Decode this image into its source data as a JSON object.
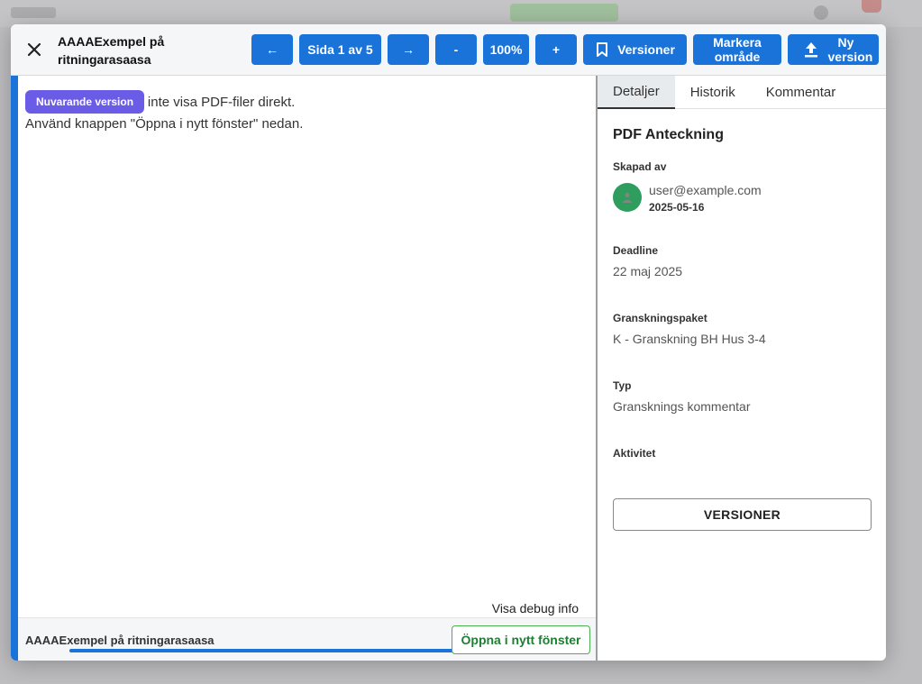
{
  "header": {
    "title": "AAAAExempel på ritningarasaasa",
    "prev_label": "←",
    "page_label": "Sida 1 av 5",
    "next_label": "→",
    "zoom_out_label": "-",
    "zoom_label": "100%",
    "zoom_in_label": "+",
    "versions_label": "Versioner",
    "mark_area_label": "Markera område",
    "new_version_label": "Ny version"
  },
  "viewer": {
    "badge": "Nuvarande version",
    "message_line1": "Din webbläsare kan inte visa PDF-filer direkt.",
    "message_line2": "Använd knappen \"Öppna i nytt fönster\" nedan.",
    "debug_link": "Visa debug info",
    "file_name": "AAAAExempel på ritningarasaasa",
    "open_button": "Öppna i nytt fönster"
  },
  "sidebar": {
    "tabs": [
      {
        "label": "Detaljer",
        "active": true
      },
      {
        "label": "Historik",
        "active": false
      },
      {
        "label": "Kommentar",
        "active": false
      }
    ],
    "details": {
      "title": "PDF Anteckning",
      "created_by_label": "Skapad av",
      "user_email": "user@example.com",
      "created_date": "2025-05-16",
      "deadline_label": "Deadline",
      "deadline_value": "22 maj 2025",
      "package_label": "Granskningspaket",
      "package_value": "K - Granskning BH Hus 3-4",
      "type_label": "Typ",
      "type_value": "Gransknings kommentar",
      "activity_label": "Aktivitet",
      "versions_button": "VERSIONER"
    }
  },
  "colors": {
    "primary": "#1a73d9",
    "badge": "#6b5ce7",
    "avatar": "#2e9d5e",
    "open_button": "#1e7e34"
  },
  "icons": {
    "close": "close-icon",
    "bookmark": "bookmark-icon",
    "upload": "upload-icon",
    "user": "user-icon"
  }
}
